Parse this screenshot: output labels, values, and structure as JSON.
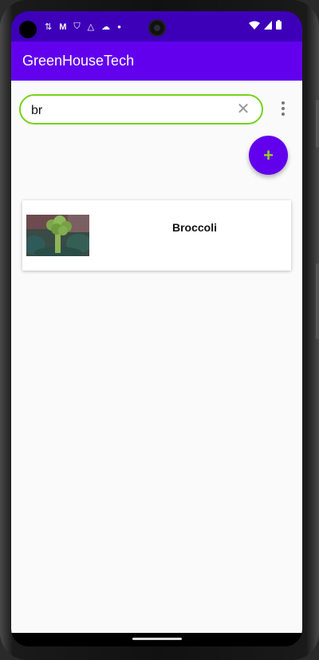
{
  "app": {
    "title": "GreenHouseTech"
  },
  "status_bar": {
    "left_icons": [
      "signal-alt-icon",
      "gmail-icon",
      "shield-icon",
      "drive-icon",
      "cloud-icon",
      "dot-icon"
    ],
    "right_icons": [
      "wifi-icon",
      "cell-signal-icon",
      "battery-icon"
    ]
  },
  "search": {
    "value": "br"
  },
  "toolbar": {
    "fab_label": "+"
  },
  "results": [
    {
      "name": "Broccoli",
      "image": "broccoli-photo"
    }
  ],
  "colors": {
    "primary": "#6200ee",
    "status_bar": "#3d00b8",
    "accent": "#76d21a",
    "fab_icon": "#9bd41a"
  }
}
